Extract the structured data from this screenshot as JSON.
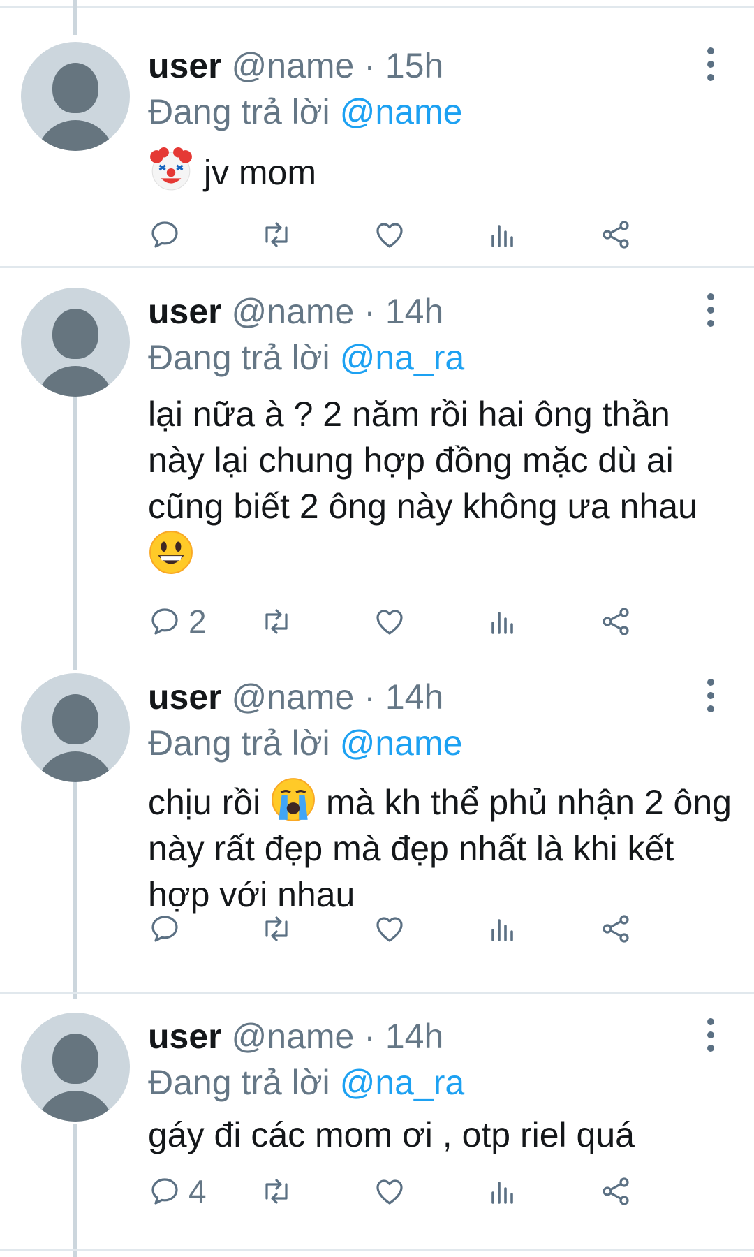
{
  "tweets": [
    {
      "user": "user",
      "handle": "@name",
      "time": "15h",
      "reply_prefix": "Đang trả lời",
      "reply_to": "@name",
      "text_before": "",
      "emoji": "clown-face",
      "text_after": " jv mom",
      "reply_count": ""
    },
    {
      "user": "user",
      "handle": "@name",
      "time": "14h",
      "reply_prefix": "Đang trả lời",
      "reply_to": "@na_ra",
      "text_before": "lại nữa à ? 2 năm rồi hai ông thần này lại chung hợp đồng mặc dù ai cũng biết 2 ông này không ưa nhau ",
      "emoji": "grinning-face",
      "text_after": "",
      "reply_count": "2"
    },
    {
      "user": "user",
      "handle": "@name",
      "time": "14h",
      "reply_prefix": "Đang trả lời",
      "reply_to": "@name",
      "text_before": "chịu rồi ",
      "emoji": "loudly-crying-face",
      "text_after": " mà kh thể phủ nhận 2 ông này rất đẹp mà đẹp nhất là khi kết hợp với nhau",
      "reply_count": ""
    },
    {
      "user": "user",
      "handle": "@name",
      "time": "14h",
      "reply_prefix": "Đang trả lời",
      "reply_to": "@na_ra",
      "text_before": "gáy đi các mom ơi , otp riel quá",
      "emoji": "",
      "text_after": "",
      "reply_count": "4"
    }
  ],
  "separator": "·",
  "icons": {
    "more": "more-vertical-icon",
    "reply": "reply-icon",
    "retweet": "retweet-icon",
    "like": "heart-icon",
    "analytics": "analytics-icon",
    "share": "share-icon"
  },
  "colors": {
    "primary_text": "#14171a",
    "secondary_text": "#657786",
    "mention": "#1da1f2",
    "avatar_bg": "#ccd6dd",
    "avatar_fg": "#66757f",
    "divider": "#e1e8ed"
  }
}
